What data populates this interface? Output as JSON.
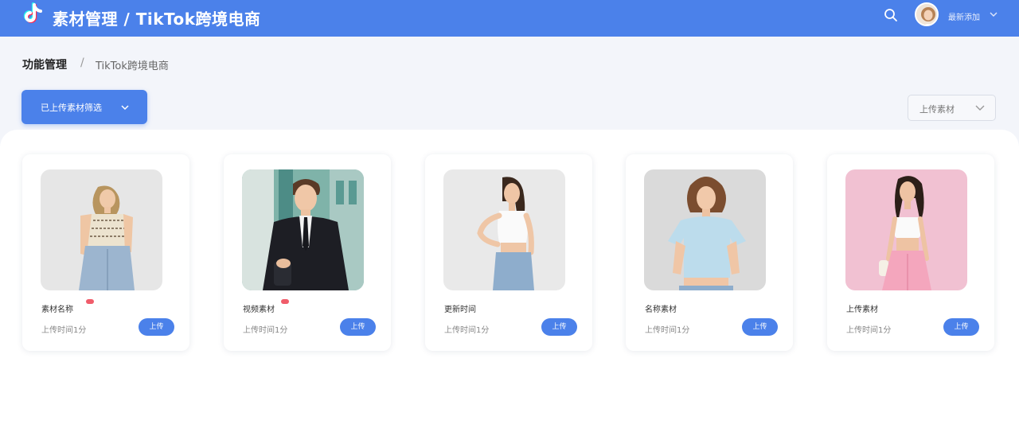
{
  "header": {
    "title": "素材管理 / TikTok跨境电商",
    "logo_icon": "tiktok-logo-icon",
    "search_icon": "search-icon",
    "username": "最新添加",
    "accent": "#4b81ea"
  },
  "breadcrumb": {
    "root": "功能管理",
    "separator": "/",
    "current": "TikTok跨境电商"
  },
  "toolbar": {
    "filter_label": "已上传素材筛选",
    "upload_select": "上传素材"
  },
  "cards": [
    {
      "name": "素材名称",
      "meta": "上传时间1分",
      "button": "上传",
      "badge": true
    },
    {
      "name": "视频素材",
      "meta": "上传时间1分",
      "button": "上传",
      "badge": true
    },
    {
      "name": "更新时间",
      "meta": "上传时间1分",
      "button": "上传",
      "badge": false
    },
    {
      "name": "名称素材",
      "meta": "上传时间1分",
      "button": "上传",
      "badge": false
    },
    {
      "name": "上传素材",
      "meta": "上传时间1分",
      "button": "上传",
      "badge": false
    }
  ]
}
